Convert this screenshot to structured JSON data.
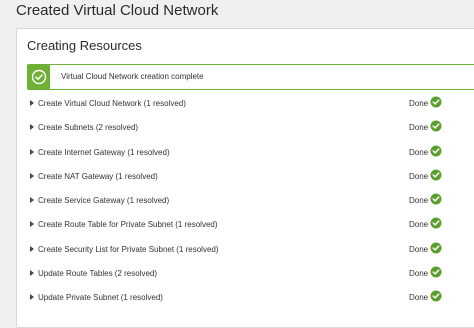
{
  "page": {
    "title": "Created Virtual Cloud Network"
  },
  "panel": {
    "title": "Creating Resources"
  },
  "banner": {
    "message": "Virtual Cloud Network creation complete",
    "color": "#6fb135",
    "icon": "check-circle-icon"
  },
  "status_color": "#5aa02c",
  "steps": [
    {
      "label": "Create Virtual Cloud Network (1 resolved)",
      "status": "Done"
    },
    {
      "label": "Create Subnets (2 resolved)",
      "status": "Done"
    },
    {
      "label": "Create Internet Gateway (1 resolved)",
      "status": "Done"
    },
    {
      "label": "Create NAT Gateway (1 resolved)",
      "status": "Done"
    },
    {
      "label": "Create Service Gateway (1 resolved)",
      "status": "Done"
    },
    {
      "label": "Create Route Table for Private Subnet (1 resolved)",
      "status": "Done"
    },
    {
      "label": "Create Security List for Private Subnet (1 resolved)",
      "status": "Done"
    },
    {
      "label": "Update Route Tables (2 resolved)",
      "status": "Done"
    },
    {
      "label": "Update Private Subnet (1 resolved)",
      "status": "Done"
    }
  ]
}
